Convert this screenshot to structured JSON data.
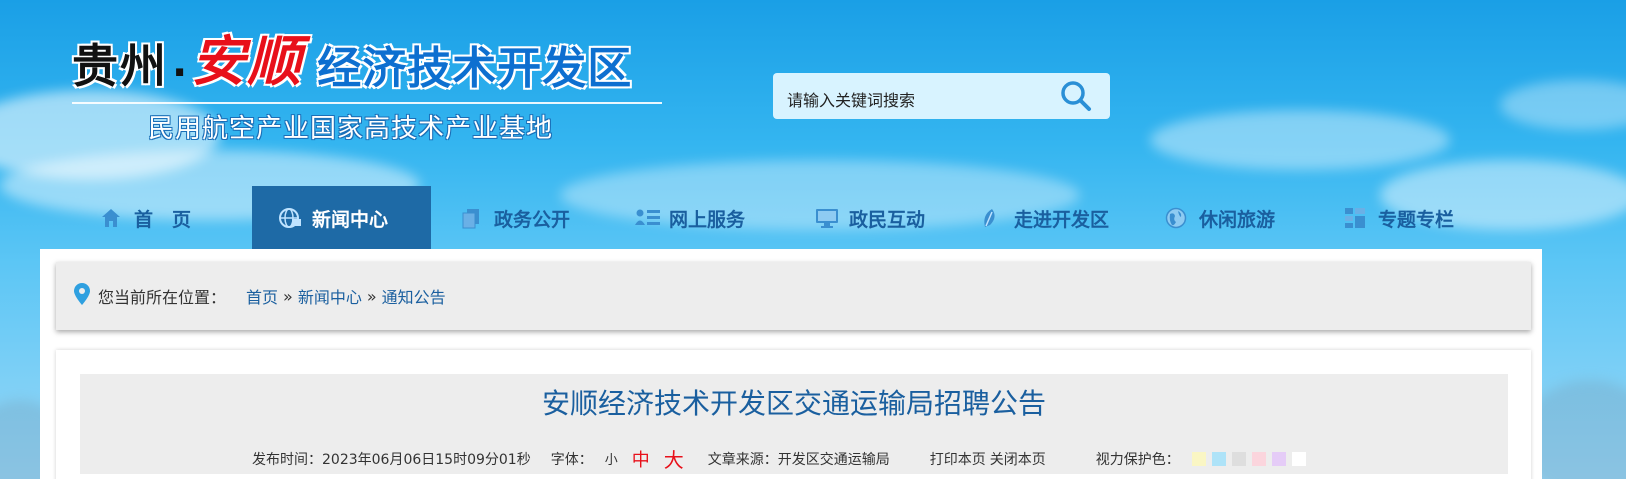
{
  "header": {
    "logo_guizhou": "贵州",
    "logo_dot": "·",
    "logo_anshun": "安顺",
    "logo_zone": "经济技术开发区",
    "logo_subtitle": "民用航空产业国家高技术产业基地"
  },
  "search": {
    "placeholder": "请输入关键词搜索",
    "icon": "search-icon"
  },
  "nav": {
    "items": [
      {
        "label": "首　页",
        "icon": "home-icon"
      },
      {
        "label": "新闻中心",
        "icon": "globe-icon",
        "active": true
      },
      {
        "label": "政务公开",
        "icon": "documents-icon"
      },
      {
        "label": "网上服务",
        "icon": "user-list-icon"
      },
      {
        "label": "政民互动",
        "icon": "monitor-icon"
      },
      {
        "label": "走进开发区",
        "icon": "leaf-icon"
      },
      {
        "label": "休闲旅游",
        "icon": "earth-icon"
      },
      {
        "label": "专题专栏",
        "icon": "grid-icon"
      }
    ]
  },
  "breadcrumb": {
    "label": "您当前所在位置：",
    "items": [
      "首页",
      "新闻中心",
      "通知公告"
    ],
    "separator": "»"
  },
  "article": {
    "title": "安顺经济技术开发区交通运输局招聘公告",
    "publish_label": "发布时间：",
    "publish_time": "2023年06月06日15时09分01秒",
    "font_label": "字体：",
    "font_small": "小",
    "font_medium": "中",
    "font_large": "大",
    "source_label": "文章来源：",
    "source": "开发区交通运输局",
    "print_label": "打印本页",
    "close_label": "关闭本页",
    "eye_care_label": "视力保护色：",
    "eye_care_colors": [
      "#faf6c4",
      "#aee3f8",
      "#dedede",
      "#fbd5dd",
      "#e5ccf7",
      "#ffffff"
    ]
  },
  "colors": {
    "accent": "#1a5f9f",
    "nav_active": "#1e6aa6",
    "red": "#e8101a"
  }
}
